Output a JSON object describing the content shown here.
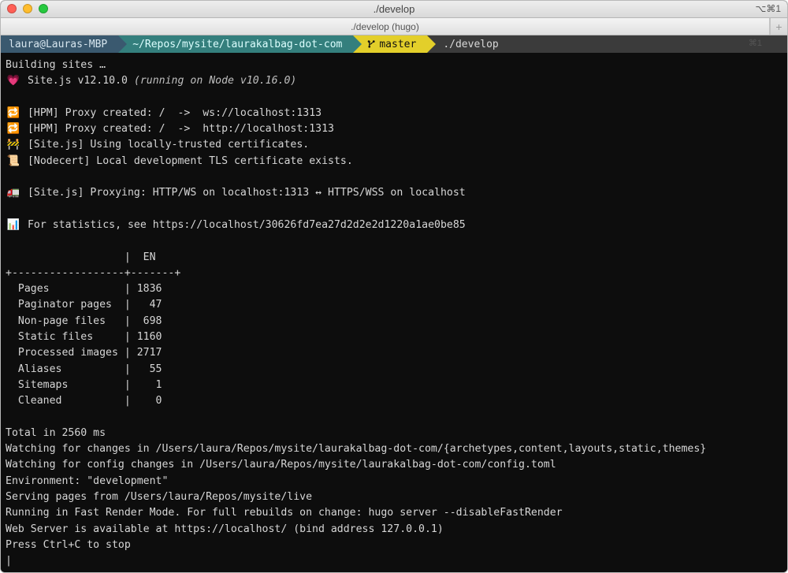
{
  "window": {
    "title": "./develop",
    "shortcut_right": "⌥⌘1"
  },
  "tab": {
    "label": "./develop (hugo)",
    "shortcut": "⌘1",
    "plus": "+"
  },
  "prompt": {
    "user_host": "laura@Lauras-MBP",
    "path": "~/Repos/mysite/laurakalbag-dot-com",
    "branch": "master",
    "command": "./develop"
  },
  "out": {
    "building": "Building sites …",
    "heart": "💗",
    "site_prefix": " Site.js v12.10.0 ",
    "site_italic": "(running on Node v10.16.0)",
    "loop": "🔁",
    "proxy1": " [HPM] Proxy created: /  ->  ws://localhost:1313",
    "proxy2": " [HPM] Proxy created: /  ->  http://localhost:1313",
    "constr": "🚧",
    "certs": " [Site.js] Using locally-trusted certificates.",
    "scroll": "📜",
    "nodecert": " [Nodecert] Local development TLS certificate exists.",
    "truck": "🚛",
    "proxying": " [Site.js] Proxying: HTTP/WS on localhost:1313 ↔ HTTPS/WSS on localhost",
    "chart": "📊",
    "stats": " For statistics, see https://localhost/30626fd7ea27d2d2e2d1220a1ae0be85",
    "table_header": "                   |  EN   ",
    "table_rule": "+------------------+-------+",
    "row_pages": "  Pages            | 1836  ",
    "row_pag": "  Paginator pages  |   47  ",
    "row_npf": "  Non-page files   |  698  ",
    "row_static": "  Static files     | 1160  ",
    "row_proc": "  Processed images | 2717  ",
    "row_alias": "  Aliases          |   55  ",
    "row_sitemap": "  Sitemaps         |    1  ",
    "row_clean": "  Cleaned          |    0  ",
    "total": "Total in 2560 ms",
    "watch1": "Watching for changes in /Users/laura/Repos/mysite/laurakalbag-dot-com/{archetypes,content,layouts,static,themes}",
    "watch2": "Watching for config changes in /Users/laura/Repos/mysite/laurakalbag-dot-com/config.toml",
    "env": "Environment: \"development\"",
    "serving": "Serving pages from /Users/laura/Repos/mysite/live",
    "fast": "Running in Fast Render Mode. For full rebuilds on change: hugo server --disableFastRender",
    "web": "Web Server is available at https://localhost/ (bind address 127.0.0.1)",
    "stop": "Press Ctrl+C to stop",
    "cursor": "|"
  }
}
